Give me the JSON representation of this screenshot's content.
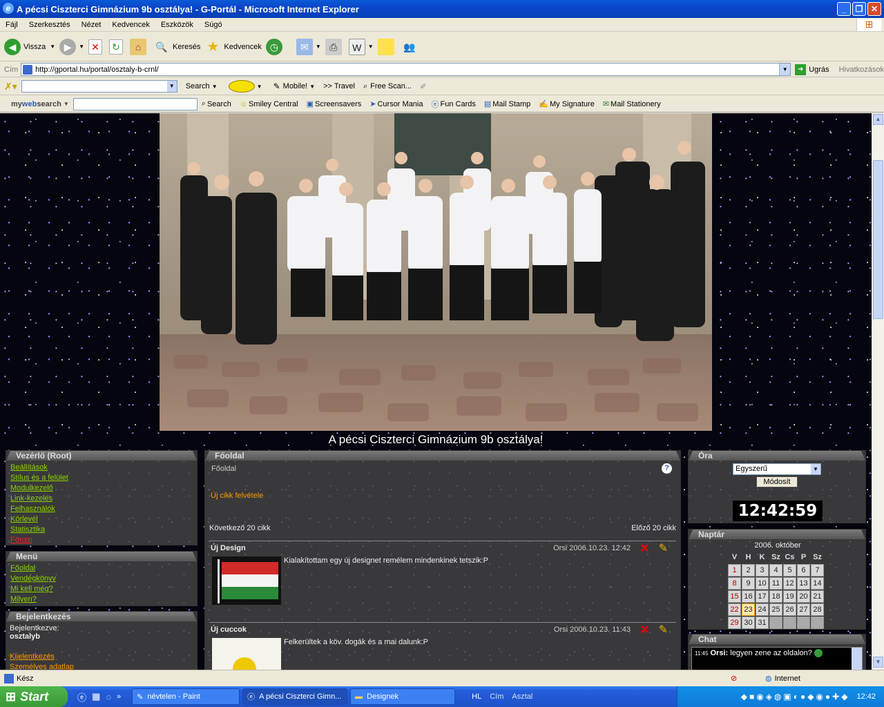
{
  "window": {
    "title": "A pécsi Ciszterci Gimnázium 9b osztálya! - G-Portál - Microsoft Internet Explorer"
  },
  "menu": [
    "Fájl",
    "Szerkesztés",
    "Nézet",
    "Kedvencek",
    "Eszközök",
    "Súgó"
  ],
  "toolbar": {
    "back": "Vissza",
    "search": "Keresés",
    "favorites": "Kedvencek"
  },
  "address": {
    "label": "Cím",
    "url": "http://gportal.hu/portal/osztaly-b-crnl/",
    "go": "Ugrás",
    "links": "Hivatkozások"
  },
  "bar3": {
    "search": "Search",
    "mobile": "Mobile!",
    "travel": ">> Travel",
    "freescan": "Free Scan..."
  },
  "bar4": {
    "brand_my": "my",
    "brand_web": "web",
    "brand_search": "search",
    "search_btn": "Search",
    "items": [
      "Smiley Central",
      "Screensavers",
      "Cursor Mania",
      "Fun Cards",
      "Mail Stamp",
      "My Signature",
      "Mail Stationery"
    ]
  },
  "page": {
    "title": "A pécsi Ciszterci Gimnázium 9b osztálya!",
    "root_panel": {
      "title": "Vezérlő (Root)",
      "items": [
        "Beállítások",
        "Stílus és a felület",
        "Modulkezelő",
        "Link-kezelés",
        "Felhasználók",
        "Körlevél",
        "Statisztika",
        "Fórum"
      ]
    },
    "menu_panel": {
      "title": "Menü",
      "items": [
        "Főoldal",
        "Vendégkönyv",
        "Mi kell még?",
        "Milyen?"
      ]
    },
    "login_panel": {
      "title": "Bejelentkezés",
      "logged_as": "Bejelentkezve:",
      "user": "osztalyb",
      "logout": "Kijelentkezés",
      "personal": "Személyes adatlap"
    },
    "main": {
      "title": "Főoldal",
      "breadcrumb": "Főoldal",
      "help": "?",
      "new_article": "Új cikk felvétele",
      "next20": "Következő 20 cikk",
      "prev20": "Előző 20 cikk",
      "articles": [
        {
          "title": "Új Design",
          "meta": "Orsi  2006.10.23. 12:42",
          "body": "Kialakítottam egy új designet remélem mindenkinek tetszik:P"
        },
        {
          "title": "Új cuccok",
          "meta": "Orsi  2006.10.23. 11:43",
          "body": "Felkerültek a köv. dogák és a mai dalunk:P"
        }
      ]
    },
    "clock": {
      "title": "Óra",
      "select": "Egyszerű",
      "modify": "Módosít",
      "time": "12:42:59"
    },
    "calendar": {
      "title": "Naptár",
      "month": "2006. október",
      "headers": [
        "V",
        "H",
        "K",
        "Sz",
        "Cs",
        "P",
        "Sz"
      ],
      "weeks": [
        [
          "1",
          "2",
          "3",
          "4",
          "5",
          "6",
          "7"
        ],
        [
          "8",
          "9",
          "10",
          "11",
          "12",
          "13",
          "14"
        ],
        [
          "15",
          "16",
          "17",
          "18",
          "19",
          "20",
          "21"
        ],
        [
          "22",
          "23",
          "24",
          "25",
          "26",
          "27",
          "28"
        ],
        [
          "29",
          "30",
          "31",
          "",
          "",
          "",
          ""
        ]
      ],
      "today": "23"
    },
    "chat": {
      "title": "Chat",
      "time": "11:45",
      "user": "Orsi:",
      "msg": "legyen zene az oldalon?"
    }
  },
  "status": {
    "text": "Kész",
    "zone": "Internet"
  },
  "taskbar": {
    "start": "Start",
    "tasks": [
      "névtelen - Paint",
      "A pécsi Ciszterci Gimn...",
      "Designek"
    ],
    "lang": "HL",
    "cim": "Cím",
    "asztal": "Asztal",
    "clock": "12:42"
  }
}
